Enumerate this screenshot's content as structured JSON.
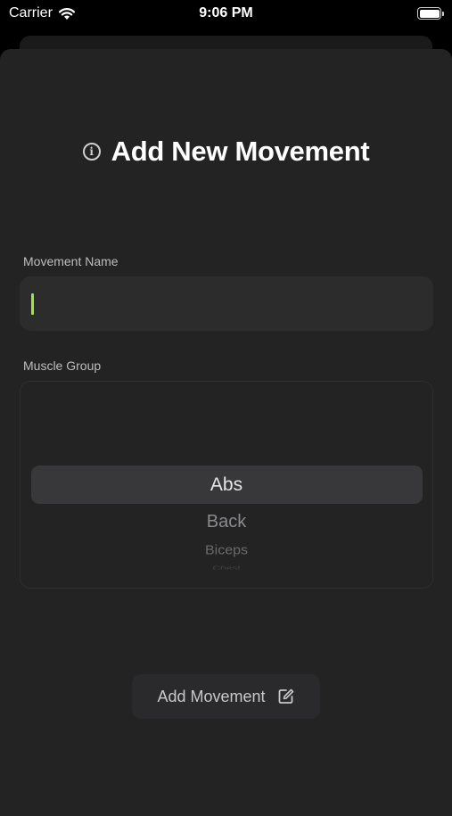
{
  "status_bar": {
    "carrier": "Carrier",
    "time": "9:06 PM",
    "wifi_icon": "wifi-icon",
    "battery_icon": "battery-full-icon"
  },
  "form": {
    "title": "Add New Movement",
    "title_icon": "info-circle-icon",
    "movement_name_label": "Movement Name",
    "movement_name_value": "",
    "muscle_group_label": "Muscle Group",
    "muscle_group_options": [
      "Abs",
      "Back",
      "Biceps",
      "Chest"
    ],
    "muscle_group_selected": "Abs",
    "submit_label": "Add Movement",
    "submit_icon": "compose-icon"
  },
  "colors": {
    "background": "#232324",
    "field": "#2c2c2d",
    "caret": "#9be83a"
  }
}
